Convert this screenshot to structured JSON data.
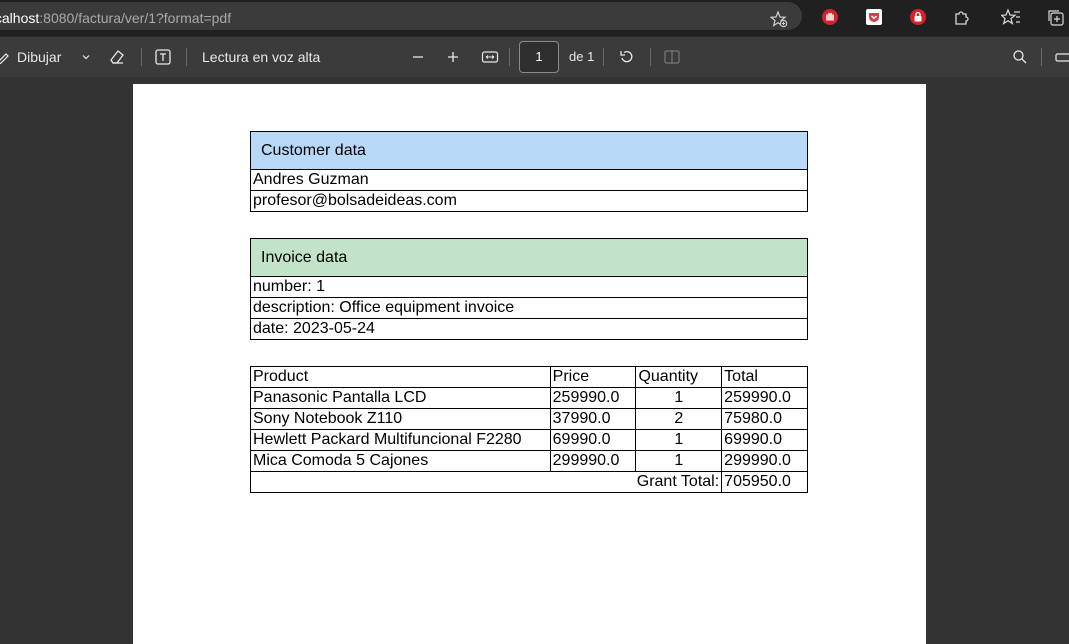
{
  "browser": {
    "url_host": "localhost",
    "url_rest": ":8080/factura/ver/1?format=pdf",
    "icons": [
      "star-add-icon",
      "adblock-icon",
      "pocket-icon",
      "lock-extension-icon",
      "extensions-icon",
      "favorites-icon",
      "collections-icon"
    ]
  },
  "toolbar": {
    "draw_label": "Dibujar",
    "read_aloud_label": "Lectura en voz alta",
    "page_number": "1",
    "page_total": "de 1"
  },
  "customer": {
    "header": "Customer data",
    "name": "Andres Guzman",
    "email": "profesor@bolsadeideas.com"
  },
  "invoice": {
    "header": "Invoice data",
    "number": "number: 1",
    "description": "description: Office equipment invoice",
    "date": "date: 2023-05-24"
  },
  "items": {
    "columns": [
      "Product",
      "Price",
      "Quantity",
      "Total"
    ],
    "rows": [
      {
        "product": "Panasonic Pantalla LCD",
        "price": "259990.0",
        "quantity": "1",
        "total": "259990.0"
      },
      {
        "product": "Sony Notebook Z110",
        "price": "37990.0",
        "quantity": "2",
        "total": "75980.0"
      },
      {
        "product": "Hewlett Packard Multifuncional F2280",
        "price": "69990.0",
        "quantity": "1",
        "total": "69990.0"
      },
      {
        "product": "Mica Comoda 5 Cajones",
        "price": "299990.0",
        "quantity": "1",
        "total": "299990.0"
      }
    ],
    "grand_total_label": "Grant Total:",
    "grand_total_value": "705950.0"
  },
  "colors": {
    "customer_header": "#b8d8f8",
    "invoice_header": "#c3e3c8"
  }
}
